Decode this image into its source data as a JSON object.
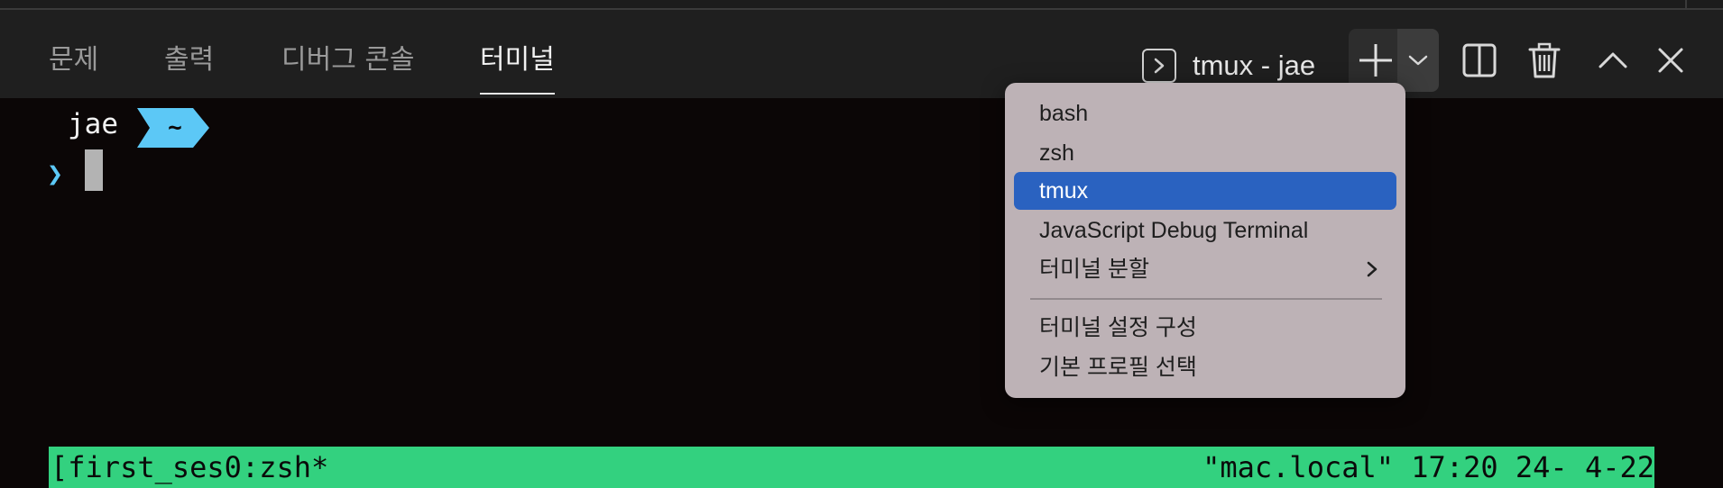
{
  "tabs": [
    {
      "label": "문제",
      "active": false
    },
    {
      "label": "출력",
      "active": false
    },
    {
      "label": "디버그 콘솔",
      "active": false
    },
    {
      "label": "터미널",
      "active": true
    }
  ],
  "terminal_selector": {
    "label": "tmux - jae"
  },
  "actions": {
    "new_terminal": "plus-icon",
    "launch_profile": "chevron-down-icon",
    "split": "split-icon",
    "kill": "trash-icon",
    "maximize": "chevron-up-icon",
    "close": "close-icon"
  },
  "prompt": {
    "user": "jae",
    "dir": "~",
    "caret": "❯"
  },
  "status_bar": {
    "left": "[first_ses0:zsh*",
    "right": "\"mac.local\" 17:20 24- 4-22"
  },
  "dropdown": {
    "items": [
      "bash",
      "zsh",
      "tmux",
      "JavaScript Debug Terminal",
      "터미널 분할"
    ],
    "selected": "tmux",
    "secondary": [
      "터미널 설정 구성",
      "기본 프로필 선택"
    ]
  },
  "colors": {
    "status_bg": "#33d17f",
    "highlight": "#2a62c0",
    "menu_bg": "#bdb2b6",
    "accent_cyan": "#5cc8f6"
  }
}
